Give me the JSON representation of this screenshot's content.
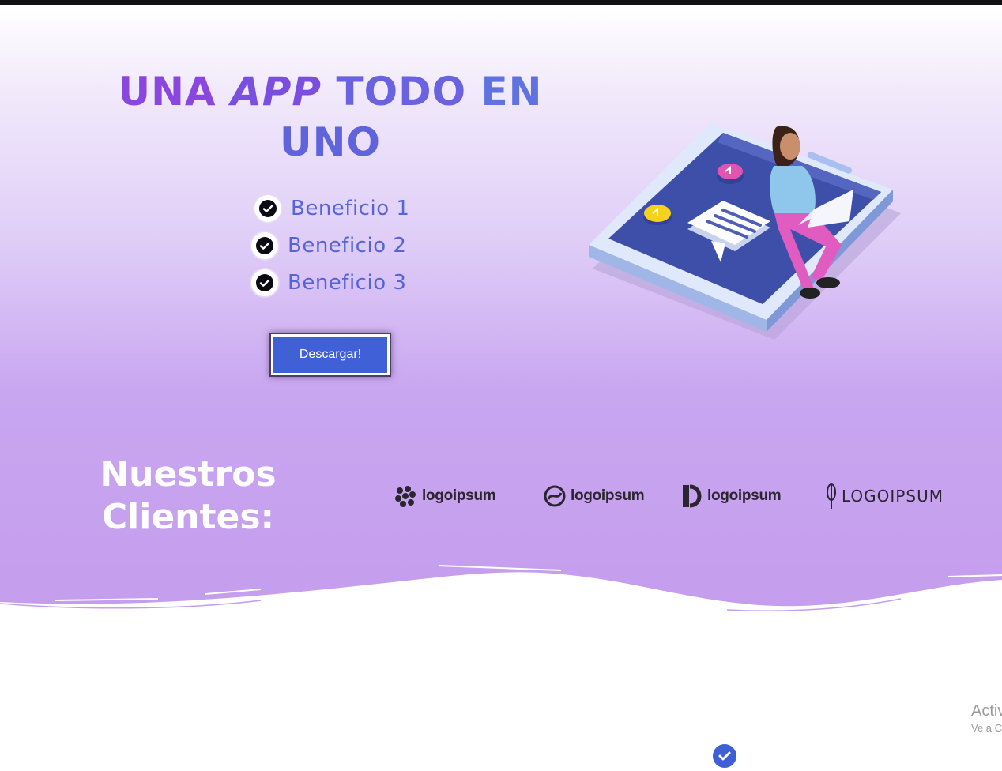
{
  "hero": {
    "title_word1": "UNA",
    "title_word2": "APP",
    "title_word3": "TODO",
    "title_word4": "EN",
    "title_word5": "UNO",
    "benefits": [
      {
        "label": "Beneficio 1"
      },
      {
        "label": "Beneficio 2"
      },
      {
        "label": "Beneficio 3"
      }
    ],
    "cta_label": "Descargar!"
  },
  "clients": {
    "title_line1": "Nuestros",
    "title_line2": "Clientes:",
    "logos": [
      {
        "text": "logoipsum"
      },
      {
        "text": "logoipsum"
      },
      {
        "text": "logoipsum"
      },
      {
        "text": "LOGOIPSUM"
      }
    ]
  },
  "watermark": {
    "line1": "Activ",
    "line2": "Ve a C"
  },
  "icons": [
    "check-icon",
    "logo-mark-icon",
    "person-on-phone-illustration"
  ],
  "colors": {
    "accent_purple": "#8a47e0",
    "accent_blue": "#5f72df",
    "button_blue": "#4060d8",
    "benefit_text": "#5565d6",
    "hero_bottom": "#c49ded"
  }
}
